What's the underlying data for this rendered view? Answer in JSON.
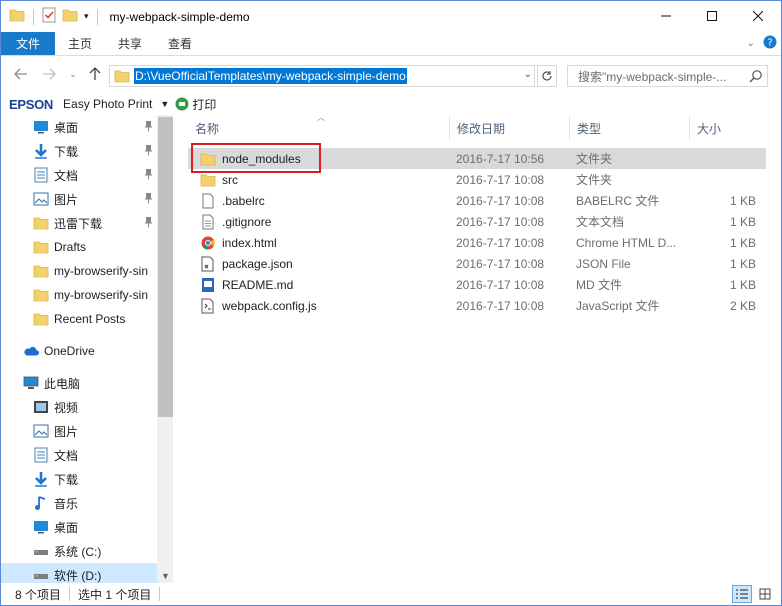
{
  "window": {
    "title": "my-webpack-simple-demo"
  },
  "ribbon": {
    "tabs": [
      "文件",
      "主页",
      "共享",
      "查看"
    ]
  },
  "address": {
    "path": "D:\\VueOfficialTemplates\\my-webpack-simple-demo",
    "search_placeholder": "搜索\"my-webpack-simple-..."
  },
  "epson": {
    "brand": "EPSON",
    "app_label": "Easy Photo Print",
    "print_label": "打印"
  },
  "nav": {
    "quick_access": [
      {
        "label": "桌面",
        "icon": "desktop-icon",
        "pinned": true
      },
      {
        "label": "下载",
        "icon": "download-icon",
        "pinned": true
      },
      {
        "label": "文档",
        "icon": "document-icon",
        "pinned": true
      },
      {
        "label": "图片",
        "icon": "pictures-icon",
        "pinned": true
      },
      {
        "label": "迅雷下载",
        "icon": "folder-icon",
        "pinned": true
      },
      {
        "label": "Drafts",
        "icon": "folder-icon",
        "pinned": false
      },
      {
        "label": "my-browserify-sin",
        "icon": "folder-icon",
        "pinned": false
      },
      {
        "label": "my-browserify-sin",
        "icon": "folder-icon",
        "pinned": false
      },
      {
        "label": "Recent Posts",
        "icon": "folder-icon",
        "pinned": false
      }
    ],
    "onedrive": "OneDrive",
    "this_pc": "此电脑",
    "pc_items": [
      {
        "label": "视频",
        "icon": "video-icon"
      },
      {
        "label": "图片",
        "icon": "pictures-icon"
      },
      {
        "label": "文档",
        "icon": "document-icon"
      },
      {
        "label": "下载",
        "icon": "download-icon"
      },
      {
        "label": "音乐",
        "icon": "music-icon"
      },
      {
        "label": "桌面",
        "icon": "desktop-icon"
      },
      {
        "label": "系统 (C:)",
        "icon": "drive-icon"
      },
      {
        "label": "软件 (D:)",
        "icon": "drive-icon",
        "selected": true
      }
    ]
  },
  "columns": {
    "name": "名称",
    "date": "修改日期",
    "type": "类型",
    "size": "大小"
  },
  "files": [
    {
      "name": "node_modules",
      "date": "2016-7-17 10:56",
      "type": "文件夹",
      "size": "",
      "icon": "folder-icon",
      "selected": true
    },
    {
      "name": "src",
      "date": "2016-7-17 10:08",
      "type": "文件夹",
      "size": "",
      "icon": "folder-icon"
    },
    {
      "name": ".babelrc",
      "date": "2016-7-17 10:08",
      "type": "BABELRC 文件",
      "size": "1 KB",
      "icon": "file-icon"
    },
    {
      "name": ".gitignore",
      "date": "2016-7-17 10:08",
      "type": "文本文档",
      "size": "1 KB",
      "icon": "text-file-icon"
    },
    {
      "name": "index.html",
      "date": "2016-7-17 10:08",
      "type": "Chrome HTML D...",
      "size": "1 KB",
      "icon": "chrome-icon"
    },
    {
      "name": "package.json",
      "date": "2016-7-17 10:08",
      "type": "JSON File",
      "size": "1 KB",
      "icon": "json-file-icon"
    },
    {
      "name": "README.md",
      "date": "2016-7-17 10:08",
      "type": "MD 文件",
      "size": "1 KB",
      "icon": "md-file-icon"
    },
    {
      "name": "webpack.config.js",
      "date": "2016-7-17 10:08",
      "type": "JavaScript 文件",
      "size": "2 KB",
      "icon": "js-file-icon"
    }
  ],
  "status": {
    "count": "8 个项目",
    "selected": "选中 1 个项目"
  }
}
